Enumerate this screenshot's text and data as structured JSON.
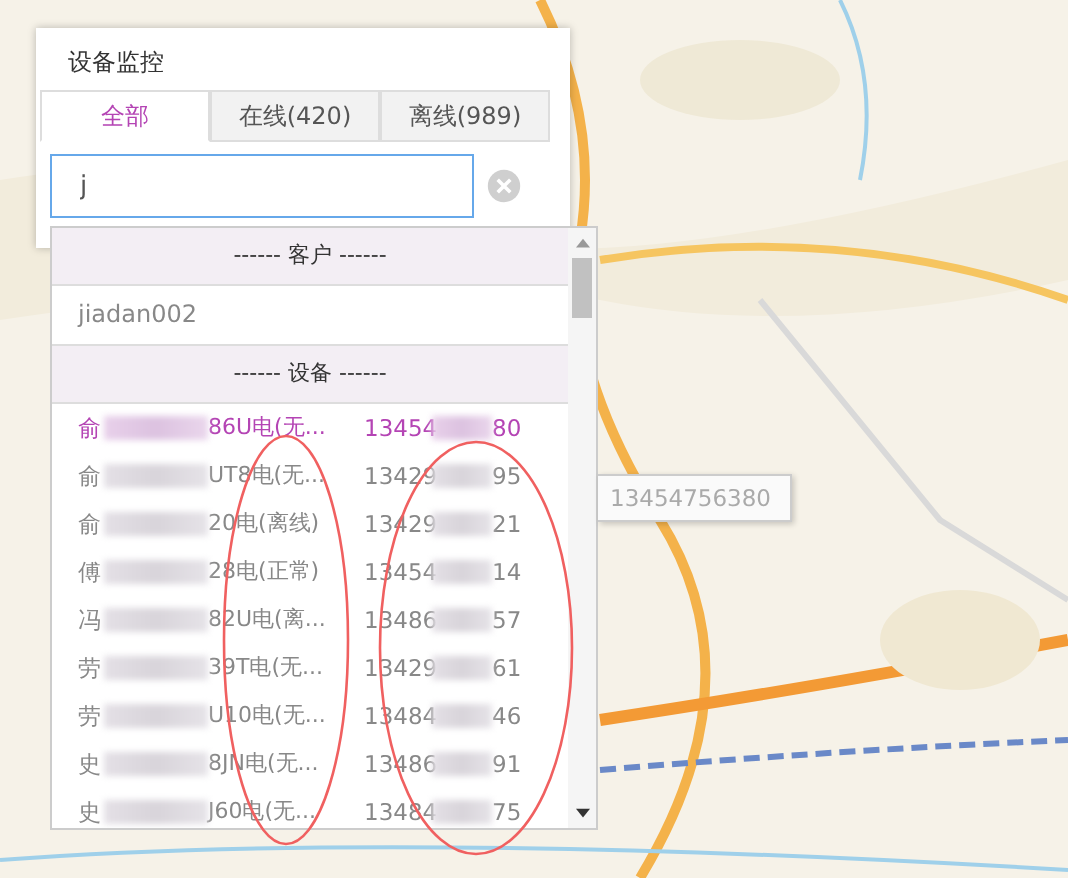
{
  "panel": {
    "title": "设备监控",
    "tabs": [
      {
        "label": "全部",
        "selected": true
      },
      {
        "label": "在线(420)",
        "selected": false
      },
      {
        "label": "离线(989)",
        "selected": false
      }
    ],
    "search": {
      "value": "j"
    },
    "dropdown": {
      "groups": [
        {
          "header": "------ 客户 ------",
          "items": [
            {
              "kind": "customer",
              "name": "jiadan002",
              "selected": false
            }
          ]
        },
        {
          "header": "------ 设备 ------",
          "items": [
            {
              "kind": "device",
              "name_start": "俞",
              "name_end": "86U电(无...",
              "phone_start": "13454",
              "phone_end": "80",
              "selected": true
            },
            {
              "kind": "device",
              "name_start": "俞",
              "name_end": "UT8电(无...",
              "phone_start": "13429",
              "phone_end": "95",
              "selected": false
            },
            {
              "kind": "device",
              "name_start": "俞",
              "name_end": "20电(离线)",
              "phone_start": "13429",
              "phone_end": "21",
              "selected": false
            },
            {
              "kind": "device",
              "name_start": "傅",
              "name_end": "28电(正常)",
              "phone_start": "13454",
              "phone_end": "14",
              "selected": false
            },
            {
              "kind": "device",
              "name_start": "冯",
              "name_end": "82U电(离...",
              "phone_start": "13486",
              "phone_end": "57",
              "selected": false
            },
            {
              "kind": "device",
              "name_start": "劳",
              "name_end": "39T电(无...",
              "phone_start": "13429",
              "phone_end": "61",
              "selected": false
            },
            {
              "kind": "device",
              "name_start": "劳",
              "name_end": "U10电(无...",
              "phone_start": "13484",
              "phone_end": "46",
              "selected": false
            },
            {
              "kind": "device",
              "name_start": "史",
              "name_end": "8JN电(无...",
              "phone_start": "13486",
              "phone_end": "91",
              "selected": false
            },
            {
              "kind": "device",
              "name_start": "史",
              "name_end": "J60电(无...",
              "phone_start": "13484",
              "phone_end": "75",
              "selected": false
            }
          ]
        }
      ]
    }
  },
  "tooltip": {
    "text": "13454756380"
  }
}
